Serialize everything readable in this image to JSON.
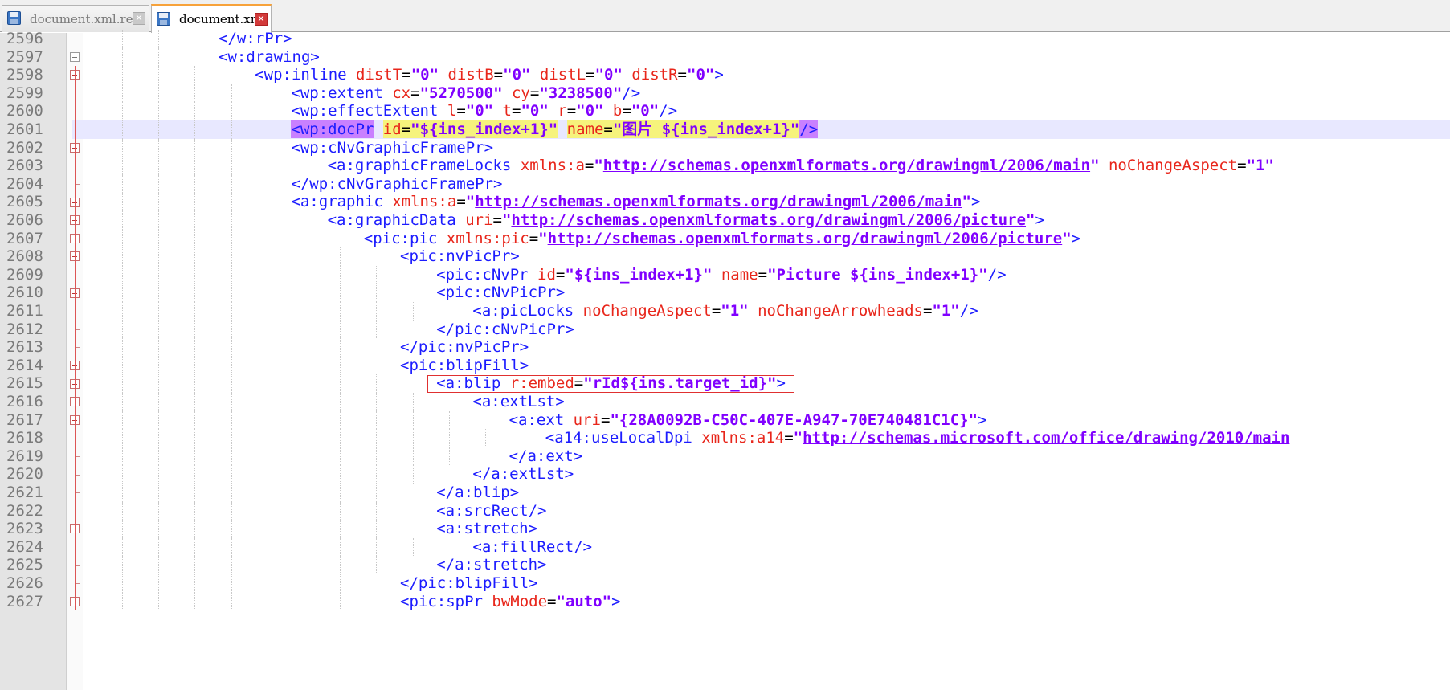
{
  "tabs": [
    {
      "label": "document.xml.rels",
      "active": false,
      "icon": "floppy-disk-icon"
    },
    {
      "label": "document.xml",
      "active": true,
      "icon": "floppy-disk-icon"
    }
  ],
  "close_glyph": "✕",
  "colors": {
    "tag": "#1c1cff",
    "attribute": "#e8261b",
    "value": "#8000ff",
    "current_line": "#e8e8ff",
    "selection": "#c980ff",
    "match_highlight": "#f6f37c",
    "annotation_box": "#e03030",
    "tab_accent": "#f7a23a"
  },
  "lines": [
    {
      "num": "2596",
      "indent": 4,
      "fold": "tick",
      "parts": [
        [
          "tag",
          "</w:rPr>"
        ]
      ]
    },
    {
      "num": "2597",
      "indent": 4,
      "fold": "open-grey",
      "parts": [
        [
          "tag",
          "<w:drawing>"
        ]
      ]
    },
    {
      "num": "2598",
      "indent": 5,
      "fold": "open",
      "parts": [
        [
          "tag",
          "<wp:inline "
        ],
        [
          "attr",
          "distT"
        ],
        [
          "eq",
          "="
        ],
        [
          "val",
          "\"0\""
        ],
        [
          "tag",
          " "
        ],
        [
          "attr",
          "distB"
        ],
        [
          "eq",
          "="
        ],
        [
          "val",
          "\"0\""
        ],
        [
          "tag",
          " "
        ],
        [
          "attr",
          "distL"
        ],
        [
          "eq",
          "="
        ],
        [
          "val",
          "\"0\""
        ],
        [
          "tag",
          " "
        ],
        [
          "attr",
          "distR"
        ],
        [
          "eq",
          "="
        ],
        [
          "val",
          "\"0\""
        ],
        [
          "tag",
          ">"
        ]
      ]
    },
    {
      "num": "2599",
      "indent": 6,
      "fold": "line",
      "parts": [
        [
          "tag",
          "<wp:extent "
        ],
        [
          "attr",
          "cx"
        ],
        [
          "eq",
          "="
        ],
        [
          "val",
          "\"5270500\""
        ],
        [
          "tag",
          " "
        ],
        [
          "attr",
          "cy"
        ],
        [
          "eq",
          "="
        ],
        [
          "val",
          "\"3238500\""
        ],
        [
          "tag",
          "/>"
        ]
      ]
    },
    {
      "num": "2600",
      "indent": 6,
      "fold": "line",
      "parts": [
        [
          "tag",
          "<wp:effectExtent "
        ],
        [
          "attr",
          "l"
        ],
        [
          "eq",
          "="
        ],
        [
          "val",
          "\"0\""
        ],
        [
          "tag",
          " "
        ],
        [
          "attr",
          "t"
        ],
        [
          "eq",
          "="
        ],
        [
          "val",
          "\"0\""
        ],
        [
          "tag",
          " "
        ],
        [
          "attr",
          "r"
        ],
        [
          "eq",
          "="
        ],
        [
          "val",
          "\"0\""
        ],
        [
          "tag",
          " "
        ],
        [
          "attr",
          "b"
        ],
        [
          "eq",
          "="
        ],
        [
          "val",
          "\"0\""
        ],
        [
          "tag",
          "/>"
        ]
      ]
    },
    {
      "num": "2601",
      "indent": 6,
      "fold": "line",
      "current": true,
      "parts": [
        [
          "tag sel",
          "<wp:docPr"
        ],
        [
          "tag",
          " "
        ],
        [
          "attr match",
          "id"
        ],
        [
          "eq match",
          "="
        ],
        [
          "val match",
          "\"${ins_index+1}\""
        ],
        [
          "tag",
          " "
        ],
        [
          "attr match",
          "name"
        ],
        [
          "eq match",
          "="
        ],
        [
          "val match",
          "\"图片 ${ins_index+1}\""
        ],
        [
          "tag sel",
          "/>"
        ]
      ]
    },
    {
      "num": "2602",
      "indent": 6,
      "fold": "open",
      "parts": [
        [
          "tag",
          "<wp:cNvGraphicFramePr>"
        ]
      ]
    },
    {
      "num": "2603",
      "indent": 7,
      "fold": "line",
      "parts": [
        [
          "tag",
          "<a:graphicFrameLocks "
        ],
        [
          "attr",
          "xmlns:a"
        ],
        [
          "eq",
          "="
        ],
        [
          "val",
          "\""
        ],
        [
          "link",
          "http://schemas.openxmlformats.org/drawingml/2006/main"
        ],
        [
          "val",
          "\""
        ],
        [
          "tag",
          " "
        ],
        [
          "attr",
          "noChangeAspect"
        ],
        [
          "eq",
          "="
        ],
        [
          "val",
          "\"1\""
        ]
      ]
    },
    {
      "num": "2604",
      "indent": 6,
      "fold": "tick",
      "parts": [
        [
          "tag",
          "</wp:cNvGraphicFramePr>"
        ]
      ]
    },
    {
      "num": "2605",
      "indent": 6,
      "fold": "open",
      "parts": [
        [
          "tag",
          "<a:graphic "
        ],
        [
          "attr",
          "xmlns:a"
        ],
        [
          "eq",
          "="
        ],
        [
          "val",
          "\""
        ],
        [
          "link",
          "http://schemas.openxmlformats.org/drawingml/2006/main"
        ],
        [
          "val",
          "\""
        ],
        [
          "tag",
          ">"
        ]
      ]
    },
    {
      "num": "2606",
      "indent": 7,
      "fold": "open",
      "parts": [
        [
          "tag",
          "<a:graphicData "
        ],
        [
          "attr",
          "uri"
        ],
        [
          "eq",
          "="
        ],
        [
          "val",
          "\""
        ],
        [
          "link",
          "http://schemas.openxmlformats.org/drawingml/2006/picture"
        ],
        [
          "val",
          "\""
        ],
        [
          "tag",
          ">"
        ]
      ]
    },
    {
      "num": "2607",
      "indent": 8,
      "fold": "open",
      "parts": [
        [
          "tag",
          "<pic:pic "
        ],
        [
          "attr",
          "xmlns:pic"
        ],
        [
          "eq",
          "="
        ],
        [
          "val",
          "\""
        ],
        [
          "link",
          "http://schemas.openxmlformats.org/drawingml/2006/picture"
        ],
        [
          "val",
          "\""
        ],
        [
          "tag",
          ">"
        ]
      ]
    },
    {
      "num": "2608",
      "indent": 9,
      "fold": "open",
      "parts": [
        [
          "tag",
          "<pic:nvPicPr>"
        ]
      ]
    },
    {
      "num": "2609",
      "indent": 10,
      "fold": "line",
      "parts": [
        [
          "tag",
          "<pic:cNvPr "
        ],
        [
          "attr",
          "id"
        ],
        [
          "eq",
          "="
        ],
        [
          "val",
          "\"${ins_index+1}\""
        ],
        [
          "tag",
          " "
        ],
        [
          "attr",
          "name"
        ],
        [
          "eq",
          "="
        ],
        [
          "val",
          "\"Picture ${ins_index+1}\""
        ],
        [
          "tag",
          "/>"
        ]
      ]
    },
    {
      "num": "2610",
      "indent": 10,
      "fold": "open",
      "parts": [
        [
          "tag",
          "<pic:cNvPicPr>"
        ]
      ]
    },
    {
      "num": "2611",
      "indent": 11,
      "fold": "line",
      "parts": [
        [
          "tag",
          "<a:picLocks "
        ],
        [
          "attr",
          "noChangeAspect"
        ],
        [
          "eq",
          "="
        ],
        [
          "val",
          "\"1\""
        ],
        [
          "tag",
          " "
        ],
        [
          "attr",
          "noChangeArrowheads"
        ],
        [
          "eq",
          "="
        ],
        [
          "val",
          "\"1\""
        ],
        [
          "tag",
          "/>"
        ]
      ]
    },
    {
      "num": "2612",
      "indent": 10,
      "fold": "tick",
      "parts": [
        [
          "tag",
          "</pic:cNvPicPr>"
        ]
      ]
    },
    {
      "num": "2613",
      "indent": 9,
      "fold": "tick",
      "parts": [
        [
          "tag",
          "</pic:nvPicPr>"
        ]
      ]
    },
    {
      "num": "2614",
      "indent": 9,
      "fold": "open",
      "parts": [
        [
          "tag",
          "<pic:blipFill>"
        ]
      ]
    },
    {
      "num": "2615",
      "indent": 10,
      "fold": "open",
      "boxed": true,
      "parts": [
        [
          "tag",
          "<a:blip "
        ],
        [
          "attr",
          "r:embed"
        ],
        [
          "eq",
          "="
        ],
        [
          "val",
          "\"rId${ins.target_id}\""
        ],
        [
          "tag",
          ">"
        ]
      ]
    },
    {
      "num": "2616",
      "indent": 11,
      "fold": "open",
      "parts": [
        [
          "tag",
          "<a:extLst>"
        ]
      ]
    },
    {
      "num": "2617",
      "indent": 12,
      "fold": "open",
      "parts": [
        [
          "tag",
          "<a:ext "
        ],
        [
          "attr",
          "uri"
        ],
        [
          "eq",
          "="
        ],
        [
          "val",
          "\"{28A0092B-C50C-407E-A947-70E740481C1C}\""
        ],
        [
          "tag",
          ">"
        ]
      ]
    },
    {
      "num": "2618",
      "indent": 13,
      "fold": "line",
      "parts": [
        [
          "tag",
          "<a14:useLocalDpi "
        ],
        [
          "attr",
          "xmlns:a14"
        ],
        [
          "eq",
          "="
        ],
        [
          "val",
          "\""
        ],
        [
          "link",
          "http://schemas.microsoft.com/office/drawing/2010/main"
        ]
      ]
    },
    {
      "num": "2619",
      "indent": 12,
      "fold": "tick",
      "parts": [
        [
          "tag",
          "</a:ext>"
        ]
      ]
    },
    {
      "num": "2620",
      "indent": 11,
      "fold": "tick",
      "parts": [
        [
          "tag",
          "</a:extLst>"
        ]
      ]
    },
    {
      "num": "2621",
      "indent": 10,
      "fold": "tick",
      "parts": [
        [
          "tag",
          "</a:blip>"
        ]
      ]
    },
    {
      "num": "2622",
      "indent": 10,
      "fold": "line",
      "parts": [
        [
          "tag",
          "<a:srcRect/>"
        ]
      ]
    },
    {
      "num": "2623",
      "indent": 10,
      "fold": "open",
      "parts": [
        [
          "tag",
          "<a:stretch>"
        ]
      ]
    },
    {
      "num": "2624",
      "indent": 11,
      "fold": "line",
      "parts": [
        [
          "tag",
          "<a:fillRect/>"
        ]
      ]
    },
    {
      "num": "2625",
      "indent": 10,
      "fold": "tick",
      "parts": [
        [
          "tag",
          "</a:stretch>"
        ]
      ]
    },
    {
      "num": "2626",
      "indent": 9,
      "fold": "tick",
      "parts": [
        [
          "tag",
          "</pic:blipFill>"
        ]
      ]
    },
    {
      "num": "2627",
      "indent": 9,
      "fold": "open",
      "parts": [
        [
          "tag",
          "<pic:spPr "
        ],
        [
          "attr",
          "bwMode"
        ],
        [
          "eq",
          "="
        ],
        [
          "val",
          "\"auto\""
        ],
        [
          "tag",
          ">"
        ]
      ]
    }
  ]
}
